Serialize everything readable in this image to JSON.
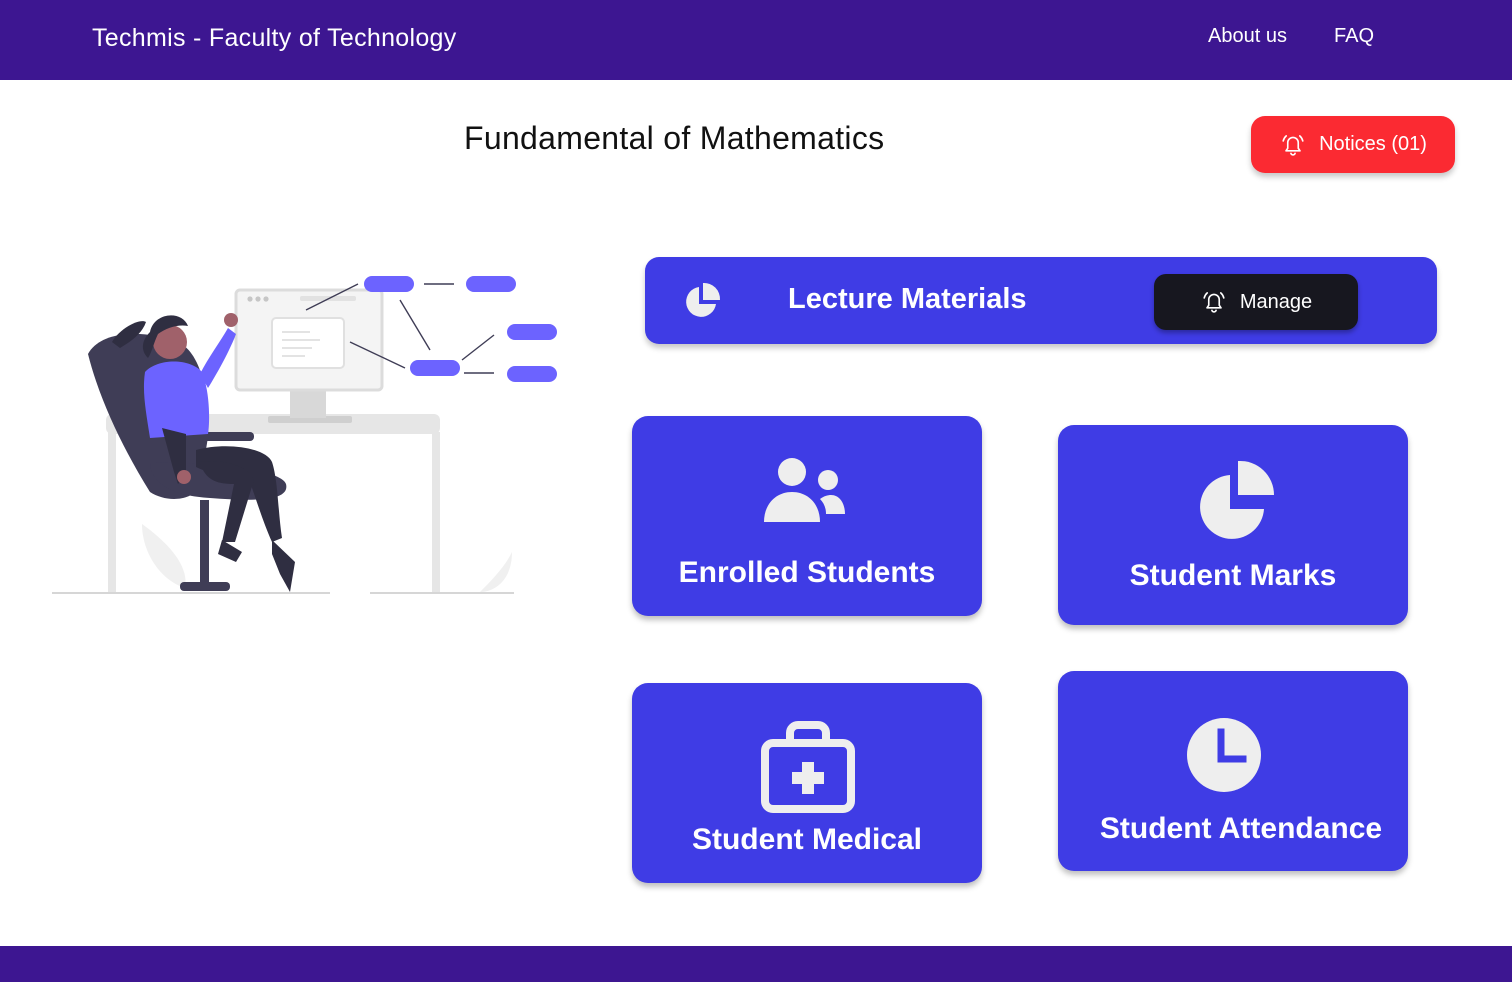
{
  "nav": {
    "brand": "Techmis - Faculty of Technology",
    "links": [
      {
        "label": "About us"
      },
      {
        "label": "FAQ"
      }
    ]
  },
  "page": {
    "title": "Fundamental of Mathematics"
  },
  "notices": {
    "label": "Notices (01)",
    "icon": "bell-icon",
    "color": "#fb2a32"
  },
  "lecture": {
    "label": "Lecture Materials",
    "icon": "pie-chart-icon",
    "manage_label": "Manage",
    "manage_icon": "bell-icon"
  },
  "cards": [
    {
      "label": "Enrolled Students",
      "icon": "users-icon"
    },
    {
      "label": "Student Marks",
      "icon": "pie-chart-icon"
    },
    {
      "label": "Student Medical",
      "icon": "medical-kit-icon"
    },
    {
      "label": "Student Attendance",
      "icon": "clock-icon"
    }
  ],
  "colors": {
    "navbar": "#3d1691",
    "accent": "#3f3ce5",
    "dark_button": "#17171f",
    "illustration_accent": "#6c63ff"
  }
}
